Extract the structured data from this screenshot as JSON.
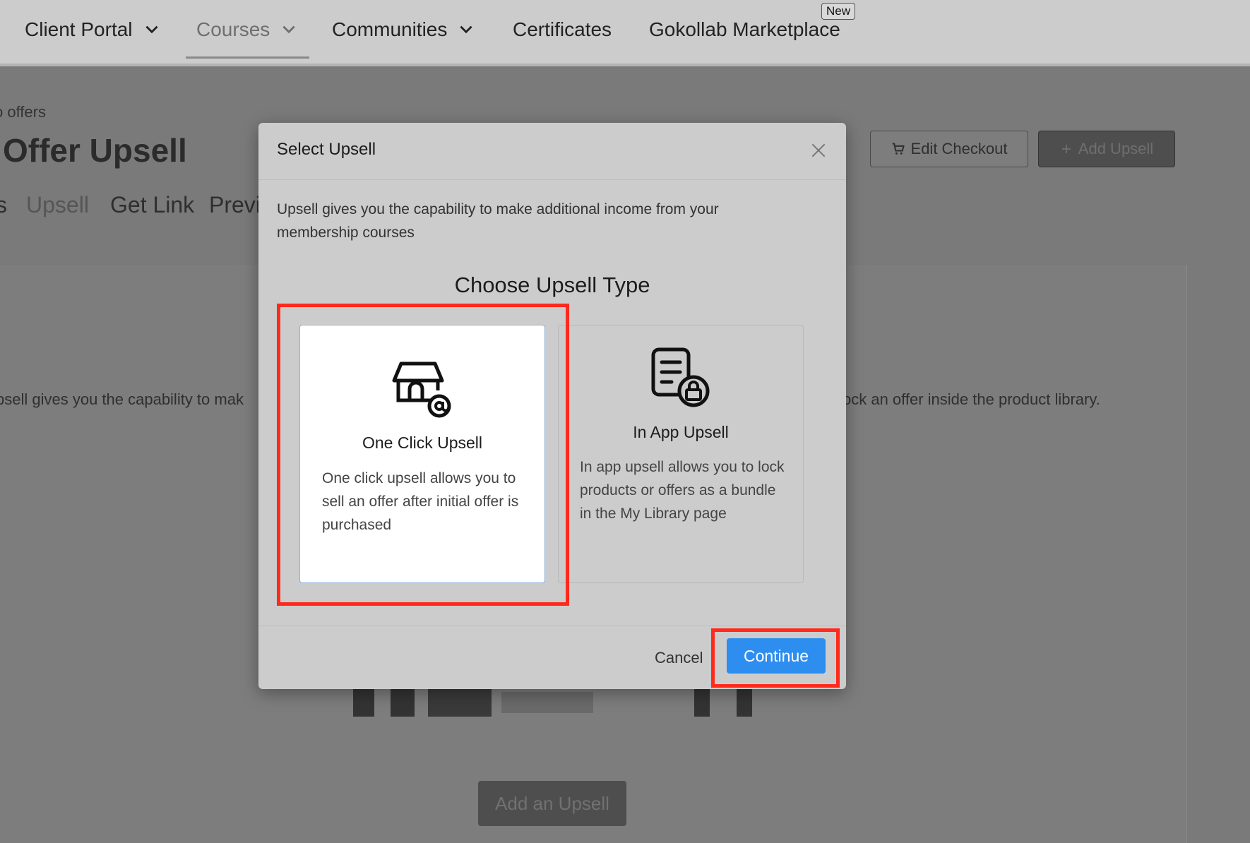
{
  "nav": {
    "items": [
      {
        "label": "Client Portal"
      },
      {
        "label": "Courses"
      },
      {
        "label": "Communities"
      },
      {
        "label": "Certificates"
      },
      {
        "label": "Gokollab Marketplace"
      }
    ],
    "badge": "New"
  },
  "page": {
    "breadcrumb": "o offers",
    "title": "Offer Upsell",
    "tabs": [
      "s",
      "Upsell",
      "Get Link",
      "Previ"
    ],
    "bg_text_left": "psell gives you the capability to mak",
    "bg_text_right": "ock an offer inside the product library.",
    "edit_checkout": "Edit Checkout",
    "add_upsell": "Add Upsell",
    "add_an_upsell": "Add an Upsell"
  },
  "modal": {
    "title": "Select Upsell",
    "description": "Upsell gives you the capability to make additional income from your membership courses",
    "choose_title": "Choose Upsell Type",
    "options": [
      {
        "label": "One Click Upsell",
        "description": "One click upsell allows you to sell an offer after initial offer is purchased",
        "icon": "store-at-icon",
        "selected": true
      },
      {
        "label": "In App Upsell",
        "description": "In app upsell allows you to lock products or offers as a bundle in the My Library page",
        "icon": "document-lock-icon",
        "selected": false
      }
    ],
    "cancel": "Cancel",
    "continue": "Continue"
  },
  "colors": {
    "accent": "#2d8ef0",
    "highlight": "#ff2a1c"
  }
}
